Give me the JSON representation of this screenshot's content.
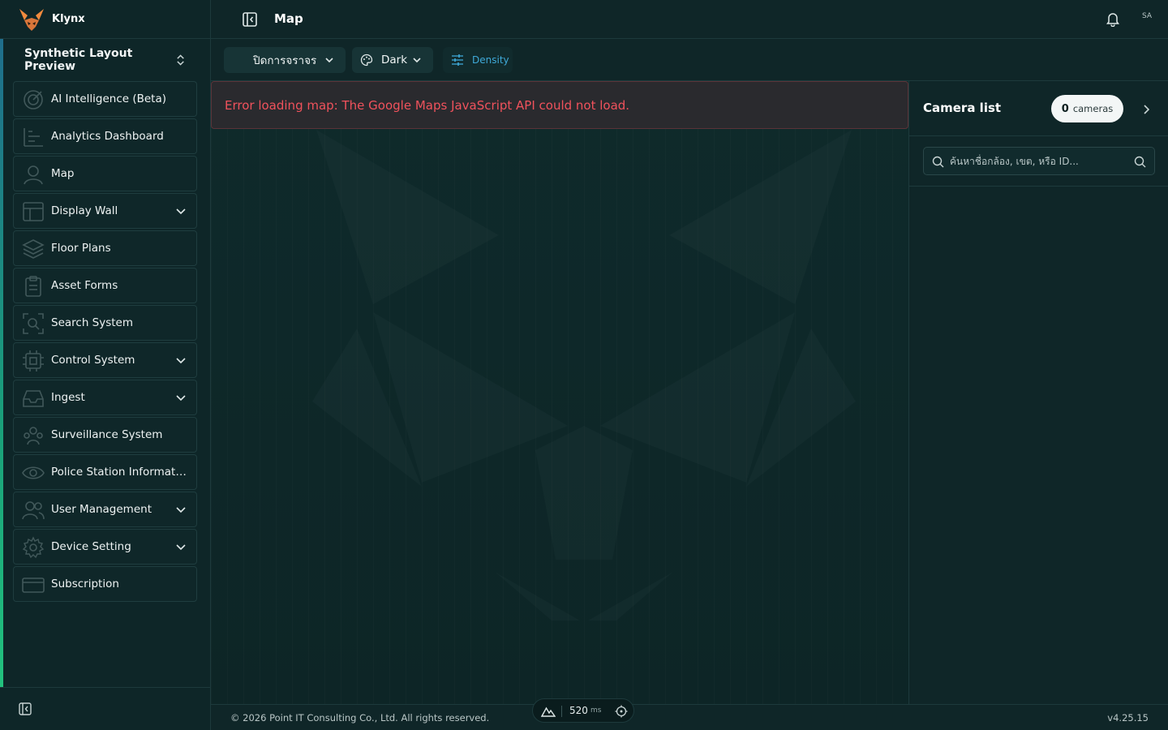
{
  "brand": {
    "name": "Klynx",
    "accent": "#f08a3e"
  },
  "workspace": {
    "name": "Synthetic Layout Preview"
  },
  "sidebar": {
    "items": [
      {
        "label": "AI Intelligence (Beta)",
        "icon": "target-icon",
        "expandable": false
      },
      {
        "label": "Analytics Dashboard",
        "icon": "chart-icon",
        "expandable": false
      },
      {
        "label": "Map",
        "icon": "user-pin-icon",
        "expandable": false
      },
      {
        "label": "Display Wall",
        "icon": "layout-icon",
        "expandable": true
      },
      {
        "label": "Floor Plans",
        "icon": "layers-icon",
        "expandable": false
      },
      {
        "label": "Asset Forms",
        "icon": "clipboard-icon",
        "expandable": false
      },
      {
        "label": "Search System",
        "icon": "scan-icon",
        "expandable": false
      },
      {
        "label": "Control System",
        "icon": "cpu-icon",
        "expandable": true
      },
      {
        "label": "Ingest",
        "icon": "inbox-icon",
        "expandable": true
      },
      {
        "label": "Surveillance System",
        "icon": "group-icon",
        "expandable": false
      },
      {
        "label": "Police Station Informati...",
        "icon": "eye-icon",
        "expandable": false
      },
      {
        "label": "User Management",
        "icon": "users-icon",
        "expandable": true
      },
      {
        "label": "Device Setting",
        "icon": "gear-icon",
        "expandable": true
      },
      {
        "label": "Subscription",
        "icon": "card-icon",
        "expandable": false
      }
    ]
  },
  "header": {
    "title": "Map",
    "avatar": "SA"
  },
  "toolbar": {
    "traffic_label": "ปิดการจราจร",
    "theme_label": "Dark",
    "density_label": "Density"
  },
  "map": {
    "error": "Error loading map: The Google Maps JavaScript API could not load."
  },
  "camera_panel": {
    "title": "Camera list",
    "count": "0",
    "count_unit": "cameras",
    "search_placeholder": "ค้นหาชื่อกล้อง, เขต, หรือ ID..."
  },
  "footer": {
    "copyright": "© 2026 Point IT Consulting Co., Ltd. All rights reserved.",
    "version": "v4.25.15",
    "latency_value": "520",
    "latency_unit": "ms"
  }
}
